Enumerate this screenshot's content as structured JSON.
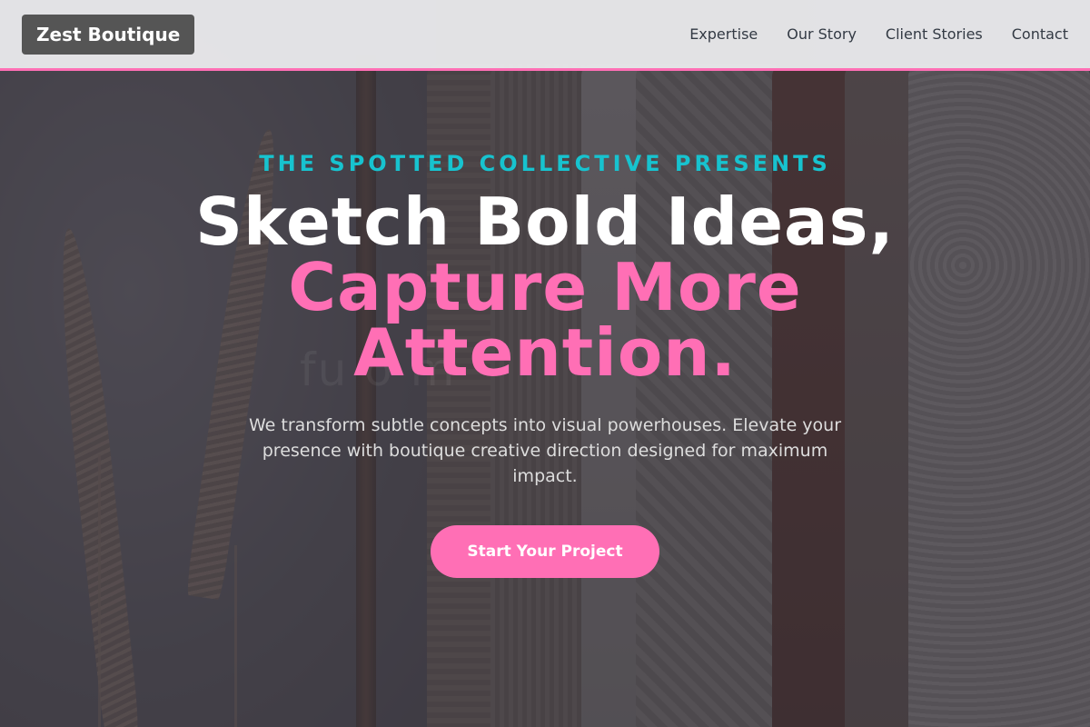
{
  "header": {
    "brand": "Zest Boutique",
    "nav": [
      "Expertise",
      "Our Story",
      "Client Stories",
      "Contact"
    ]
  },
  "hero": {
    "kicker": "THE SPOTTED COLLECTIVE PRESENTS",
    "headline_line1": "Sketch Bold Ideas,",
    "headline_line2": "Capture More",
    "headline_line3": "Attention.",
    "lead": "We transform subtle concepts into visual powerhouses. Elevate your presence with boutique creative direction designed for maximum impact.",
    "cta": "Start Your Project",
    "watermark": "fu        o        m"
  },
  "colors": {
    "accent_pink": "#ff6fb5",
    "accent_teal": "#17c3cf",
    "brand_bg": "#555555"
  }
}
